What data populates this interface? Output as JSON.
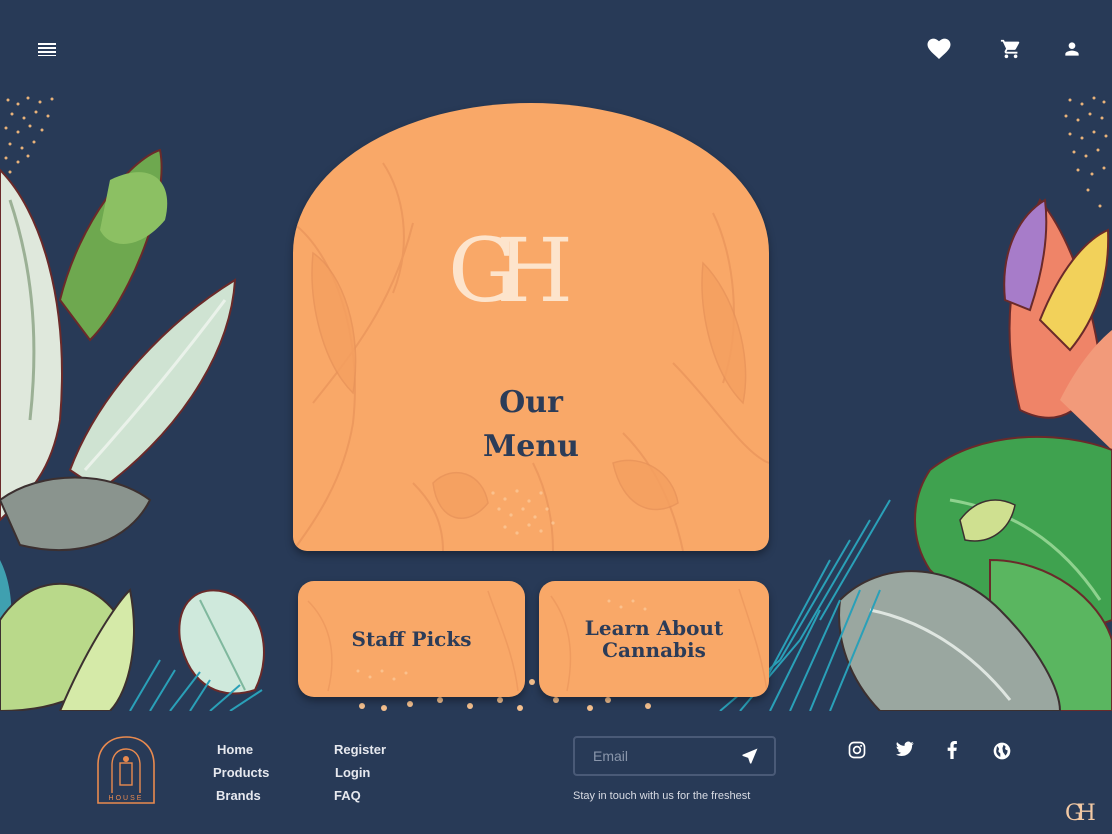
{
  "header": {
    "menu_icon": "hamburger-menu-icon",
    "heart_icon": "heart-icon",
    "cart_icon": "cart-icon",
    "user_icon": "user-icon"
  },
  "main": {
    "logo_text": "GH",
    "card_title_line1": "Our",
    "card_title_line2": "Menu",
    "tiles": [
      {
        "label": "Staff Picks"
      },
      {
        "label_line1": "Learn About",
        "label_line2": "Cannabis"
      }
    ]
  },
  "footer": {
    "brand_text": "HOUSE",
    "links_col1": [
      "Home",
      "Products",
      "Brands"
    ],
    "links_col2": [
      "Register",
      "Login",
      "FAQ"
    ],
    "email_placeholder": "Email",
    "stay_text": "Stay in touch with us for the freshest",
    "social_icons": [
      "instagram-icon",
      "twitter-icon",
      "facebook-icon",
      "globe-icon"
    ],
    "corner_logo_text": "GH"
  },
  "colors": {
    "background": "#283a57",
    "accent": "#f9a868",
    "card_text": "#2c3c58"
  }
}
